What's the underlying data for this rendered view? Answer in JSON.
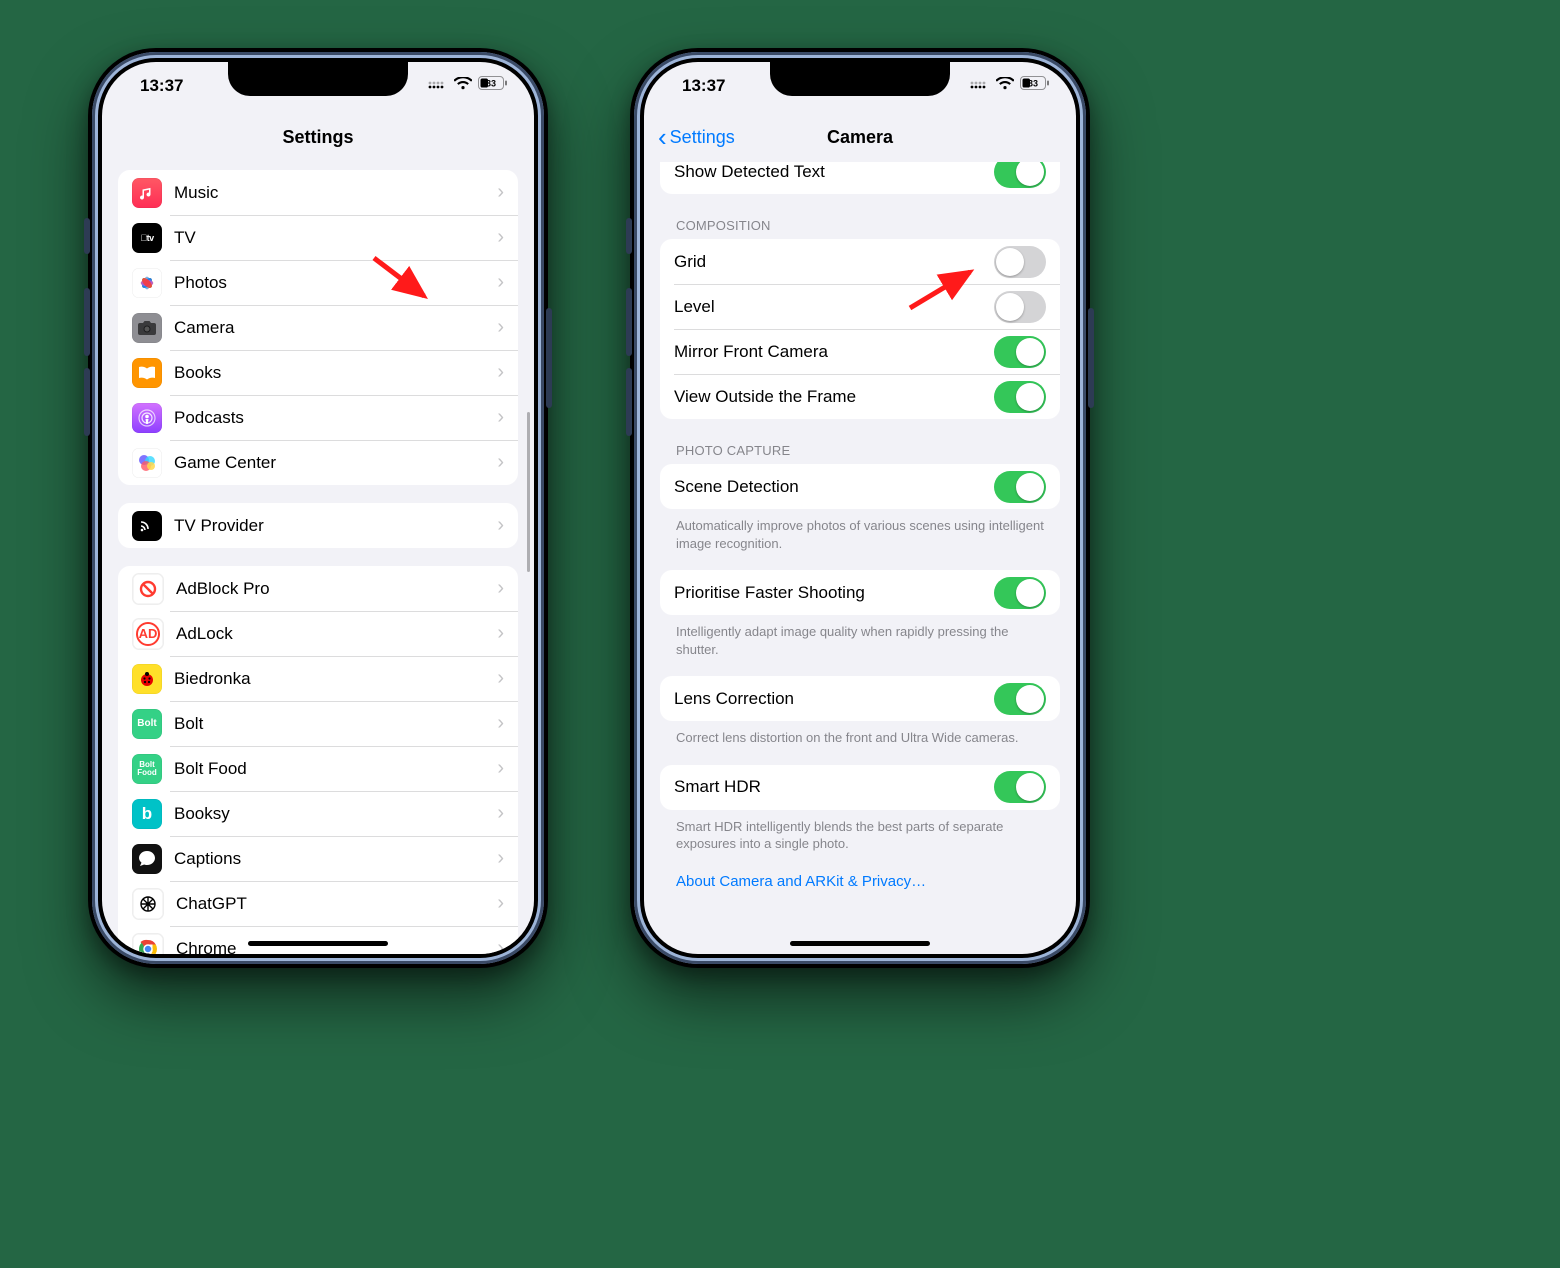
{
  "status": {
    "time": "13:37",
    "battery": "33"
  },
  "phone1": {
    "title": "Settings",
    "group1": [
      {
        "label": "Music"
      },
      {
        "label": "TV"
      },
      {
        "label": "Photos"
      },
      {
        "label": "Camera"
      },
      {
        "label": "Books"
      },
      {
        "label": "Podcasts"
      },
      {
        "label": "Game Center"
      }
    ],
    "group2": [
      {
        "label": "TV Provider"
      }
    ],
    "group3": [
      {
        "label": "AdBlock Pro"
      },
      {
        "label": "AdLock"
      },
      {
        "label": "Biedronka"
      },
      {
        "label": "Bolt"
      },
      {
        "label": "Bolt Food"
      },
      {
        "label": "Booksy"
      },
      {
        "label": "Captions"
      },
      {
        "label": "ChatGPT"
      },
      {
        "label": "Chrome"
      }
    ]
  },
  "phone2": {
    "back": "Settings",
    "title": "Camera",
    "partial_row": {
      "label": "Show Detected Text",
      "on": true
    },
    "section_composition": "COMPOSITION",
    "composition": [
      {
        "label": "Grid",
        "on": false
      },
      {
        "label": "Level",
        "on": false
      },
      {
        "label": "Mirror Front Camera",
        "on": true
      },
      {
        "label": "View Outside the Frame",
        "on": true
      }
    ],
    "section_photo": "PHOTO CAPTURE",
    "scene": {
      "label": "Scene Detection",
      "on": true,
      "footer": "Automatically improve photos of various scenes using intelligent image recognition."
    },
    "prioritise": {
      "label": "Prioritise Faster Shooting",
      "on": true,
      "footer": "Intelligently adapt image quality when rapidly pressing the shutter."
    },
    "lens": {
      "label": "Lens Correction",
      "on": true,
      "footer": "Correct lens distortion on the front and Ultra Wide cameras."
    },
    "hdr": {
      "label": "Smart HDR",
      "on": true,
      "footer": "Smart HDR intelligently blends the best parts of separate exposures into a single photo."
    },
    "link": "About Camera and ARKit & Privacy…"
  }
}
